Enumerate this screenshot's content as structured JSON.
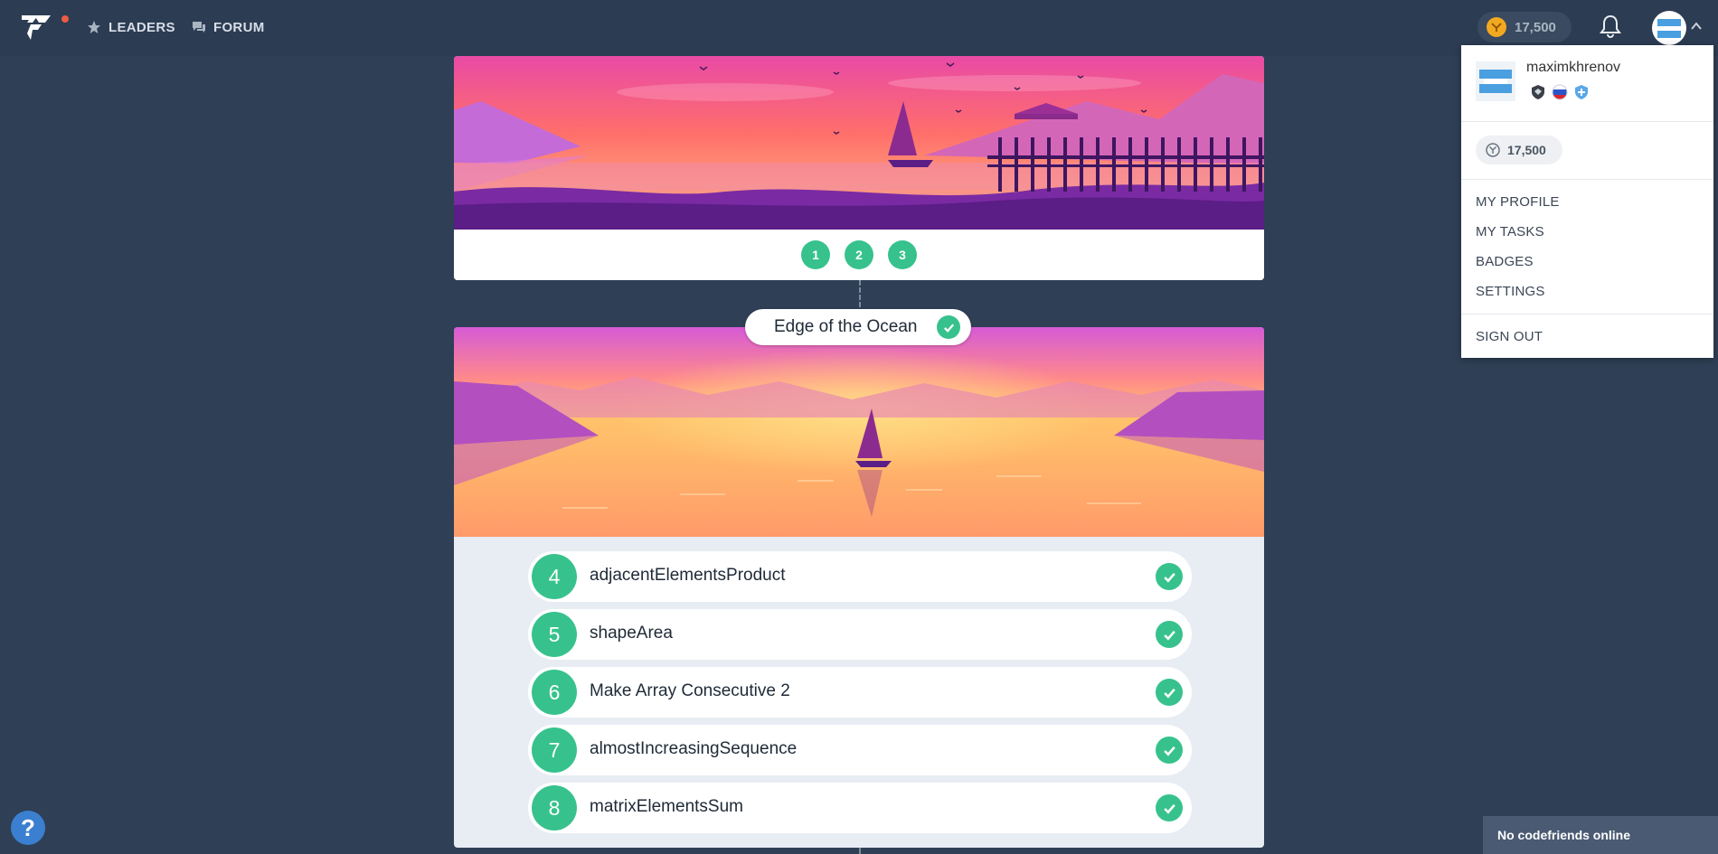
{
  "nav": {
    "links": [
      {
        "label": "LEADERS",
        "icon": "star-icon"
      },
      {
        "label": "FORUM",
        "icon": "forum-icon"
      }
    ],
    "coins": "17,500",
    "notification_icon": "bell-icon"
  },
  "arcade": {
    "pager": [
      "1",
      "2",
      "3"
    ],
    "chapter_title": "Edge of the Ocean",
    "tasks": [
      {
        "number": "4",
        "title": "adjacentElementsProduct"
      },
      {
        "number": "5",
        "title": "shapeArea"
      },
      {
        "number": "6",
        "title": "Make Array Consecutive 2"
      },
      {
        "number": "7",
        "title": "almostIncreasingSequence"
      },
      {
        "number": "8",
        "title": "matrixElementsSum"
      }
    ]
  },
  "user_menu": {
    "username": "maximkhrenov",
    "coins": "17,500",
    "items": [
      "MY PROFILE",
      "MY TASKS",
      "BADGES",
      "SETTINGS"
    ],
    "sign_out": "SIGN OUT"
  },
  "help": {
    "label": "?"
  },
  "friends_bar": {
    "label": "No codefriends online"
  },
  "colors": {
    "background": "#2f3f55",
    "accent_green": "#37c28d",
    "coin": "#f2a91f"
  }
}
